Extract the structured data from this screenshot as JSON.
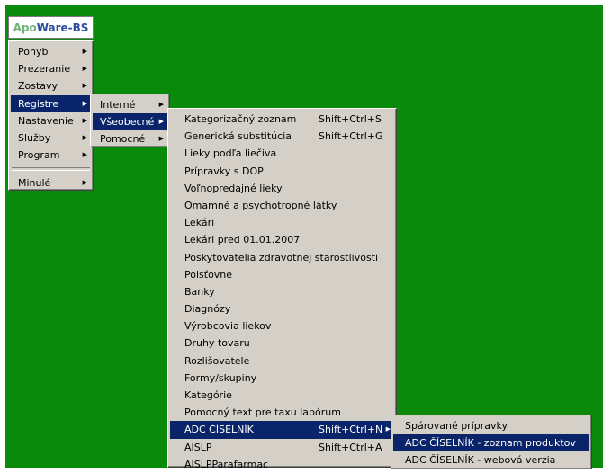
{
  "app": {
    "logo_part1": "Apo",
    "logo_part2": "Ware-BS"
  },
  "colors": {
    "desktop": "#0a8a0a",
    "menu_bg": "#d4d0c8",
    "highlight": "#0a246a",
    "logo_green": "#6fb27a",
    "logo_blue": "#2a4fa0"
  },
  "arrow_glyph": "▶",
  "main_menu": [
    {
      "label": "Pohyb"
    },
    {
      "label": "Prezeranie"
    },
    {
      "label": "Zostavy"
    },
    {
      "label": "Registre",
      "selected": true
    },
    {
      "label": "Nastavenie"
    },
    {
      "label": "Služby"
    },
    {
      "label": "Program"
    },
    {
      "label": "Minulé"
    }
  ],
  "registre_menu": [
    {
      "label": "Interné"
    },
    {
      "label": "Všeobecné",
      "selected": true
    },
    {
      "label": "Pomocné"
    }
  ],
  "vseobecne_menu": [
    {
      "label": "Kategorizačný zoznam",
      "shortcut": "Shift+Ctrl+S"
    },
    {
      "label": "Generická substitúcia",
      "shortcut": "Shift+Ctrl+G"
    },
    {
      "label": "Lieky podľa liečiva"
    },
    {
      "label": "Prípravky s DOP"
    },
    {
      "label": "Voľnopredajné lieky"
    },
    {
      "label": "Omamné a psychotropné látky"
    },
    {
      "label": "Lekári"
    },
    {
      "label": "Lekári pred 01.01.2007"
    },
    {
      "label": "Poskytovatelia zdravotnej starostlivosti"
    },
    {
      "label": "Poisťovne"
    },
    {
      "label": "Banky"
    },
    {
      "label": "Diagnózy"
    },
    {
      "label": "Výrobcovia liekov"
    },
    {
      "label": "Druhy tovaru"
    },
    {
      "label": "Rozlišovatele"
    },
    {
      "label": "Formy/skupiny"
    },
    {
      "label": "Kategórie"
    },
    {
      "label": "Pomocný text pre taxu labórum"
    },
    {
      "label": "ADC ČÍSELNÍK",
      "shortcut": "Shift+Ctrl+N",
      "selected": true
    },
    {
      "label": "AISLP",
      "shortcut": "Shift+Ctrl+A"
    },
    {
      "label": "AISLPParafarmac"
    }
  ],
  "adc_menu": [
    {
      "label": "Spárované prípravky"
    },
    {
      "label": "ADC ČÍSELNÍK - zoznam produktov",
      "selected": true
    },
    {
      "label": "ADC ČÍSELNÍK - webová verzia"
    }
  ]
}
